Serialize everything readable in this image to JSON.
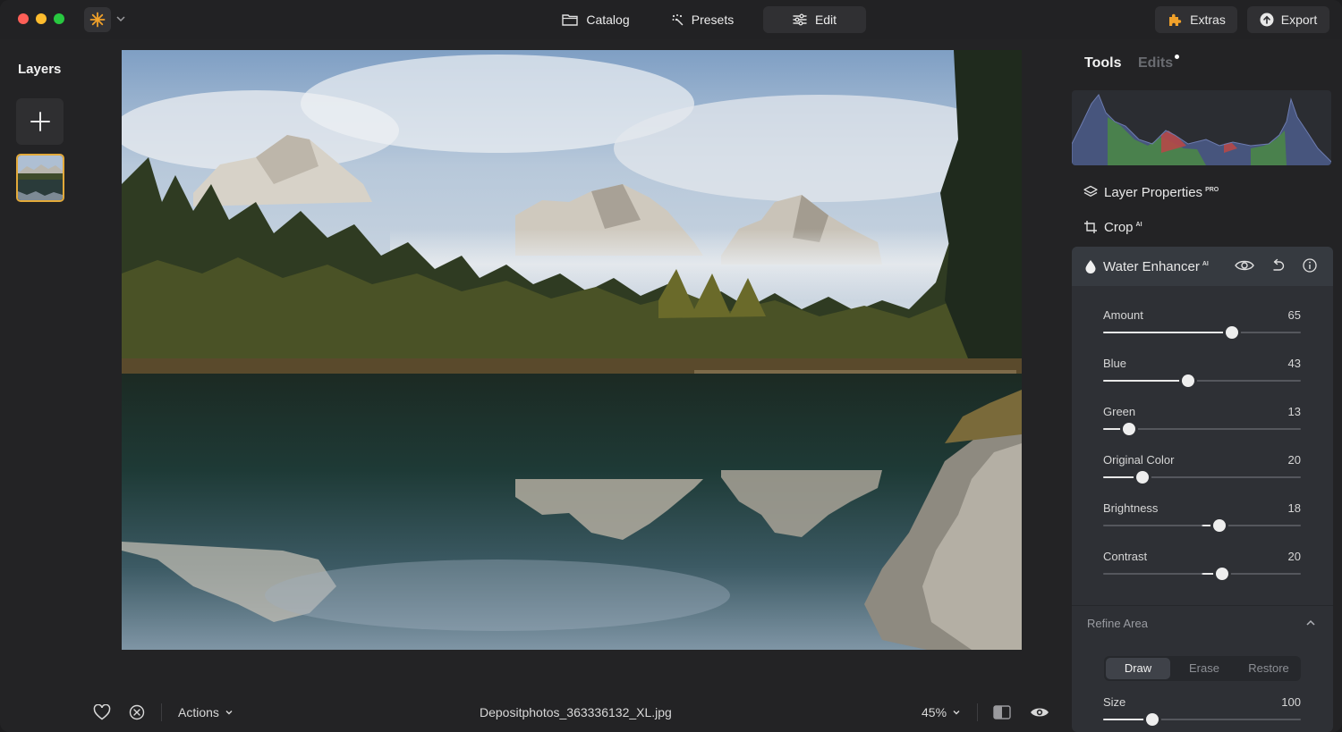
{
  "topbar": {
    "tabs": [
      {
        "label": "Catalog",
        "icon": "folder-icon"
      },
      {
        "label": "Presets",
        "icon": "sparkle-icon"
      },
      {
        "label": "Edit",
        "icon": "sliders-icon",
        "active": true
      }
    ],
    "extras_label": "Extras",
    "export_label": "Export"
  },
  "layers": {
    "title": "Layers"
  },
  "bottombar": {
    "actions_label": "Actions",
    "filename": "Depositphotos_363336132_XL.jpg",
    "zoom": "45%"
  },
  "panel": {
    "tabs": {
      "tools": "Tools",
      "edits": "Edits"
    },
    "tools": [
      {
        "label": "Layer Properties",
        "badge": "PRO",
        "icon": "layers-icon"
      },
      {
        "label": "Crop",
        "badge": "AI",
        "icon": "crop-icon"
      }
    ],
    "enhancer": {
      "title": "Water Enhancer",
      "badge": "AI",
      "sliders": [
        {
          "label": "Amount",
          "value": "65",
          "fraction": 0.65
        },
        {
          "label": "Blue",
          "value": "43",
          "fraction": 0.43
        },
        {
          "label": "Green",
          "value": "13",
          "fraction": 0.13
        },
        {
          "label": "Original Color",
          "value": "20",
          "fraction": 0.2
        },
        {
          "label": "Brightness",
          "value": "18",
          "fraction": 0.59,
          "bipolar": true
        },
        {
          "label": "Contrast",
          "value": "20",
          "fraction": 0.6,
          "bipolar": true
        }
      ]
    },
    "refine": {
      "title": "Refine Area",
      "modes": [
        "Draw",
        "Erase",
        "Restore"
      ],
      "active_mode": "Draw",
      "size_label": "Size",
      "size_value": "100",
      "size_fraction": 0.25
    }
  },
  "colors": {
    "accent": "#e2a93a",
    "panel_bg": "#2e3035",
    "window_bg": "#232325"
  }
}
